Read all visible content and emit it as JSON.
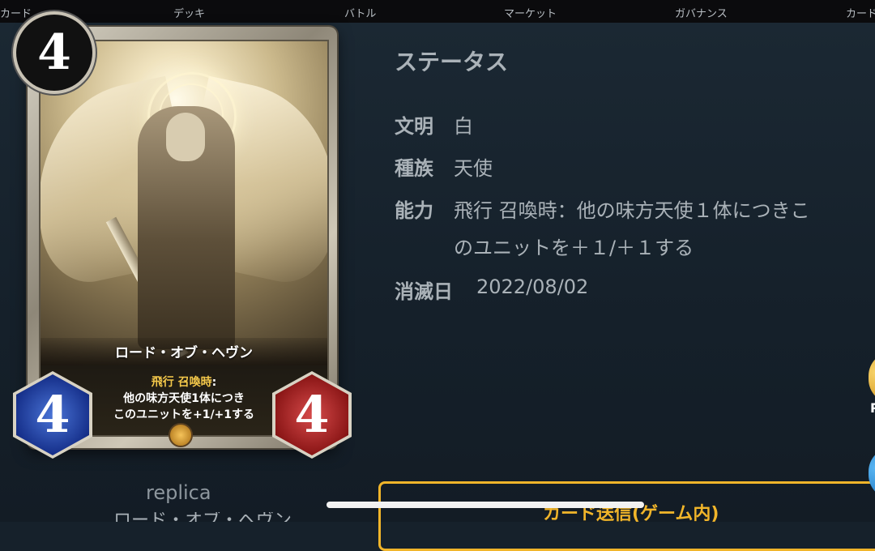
{
  "nav": {
    "tabs": [
      "カード",
      "デッキ",
      "バトル",
      "マーケット",
      "ガバナンス",
      "カード"
    ]
  },
  "card": {
    "cost": "4",
    "name": "ロード・オブ・ヘヴン",
    "ability_keywords": "飛行 召喚時",
    "ability_colon": ":",
    "ability_line2": "他の味方天使1体につき",
    "ability_line3": "このユニットを+1/+1する",
    "attack": "4",
    "health": "4"
  },
  "status": {
    "title": "ステータス",
    "civilization_label": "文明",
    "civilization_value": "白",
    "race_label": "種族",
    "race_value": "天使",
    "ability_label": "能力",
    "ability_value_line1": "飛行 召喚時：他の味方天使１体につきこ",
    "ability_value_line2": "のユニットを＋１/＋１する",
    "expiry_label": "消滅日",
    "expiry_value": "2022/08/02"
  },
  "footer": {
    "replica": "replica",
    "cut_name": "ロード・オブ・ヘヴン",
    "send_button": "カード送信(ゲーム内)",
    "side_letter": "P"
  },
  "colors": {
    "background": "#16212b",
    "accent": "#f1b52a",
    "ability_keyword": "#f4c84a"
  }
}
